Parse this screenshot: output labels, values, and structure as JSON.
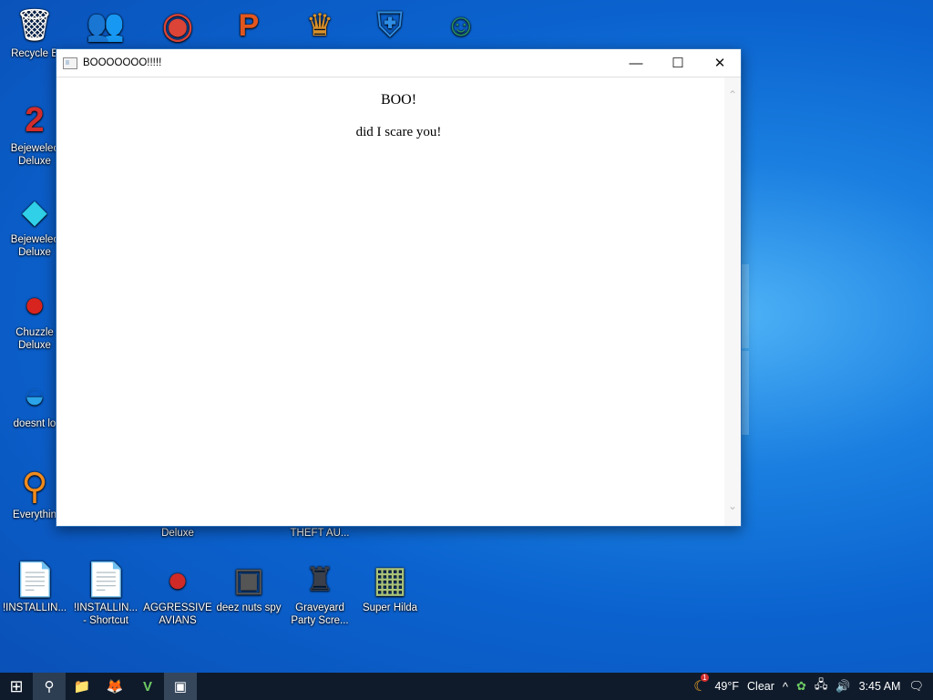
{
  "desktop": {
    "icons": [
      {
        "label": "Recycle B",
        "glyph": "🗑",
        "color": "#d8e7f5"
      },
      {
        "label": "",
        "glyph": "👥",
        "color": "#3fa34d"
      },
      {
        "label": "",
        "glyph": "◉",
        "color": "#db4437"
      },
      {
        "label": "",
        "glyph": "P",
        "color": "#e2561e"
      },
      {
        "label": "",
        "glyph": "♛",
        "color": "#d9912a"
      },
      {
        "label": "",
        "glyph": "⛨",
        "color": "#2f8de4"
      },
      {
        "label": "",
        "glyph": "☺",
        "color": "#2a8f5c"
      },
      {
        "label": "Bejewelec\nDeluxe",
        "glyph": "2",
        "color": "#d12d2d"
      },
      {
        "label": "Bejewelec\nDeluxe",
        "glyph": "◆",
        "color": "#2fd0e8"
      },
      {
        "label": "Chuzzle\nDeluxe",
        "glyph": "●",
        "color": "#d8241e"
      },
      {
        "label": "doesnt lo",
        "glyph": "◒",
        "color": "#2aa3e8"
      },
      {
        "label": "Everythin",
        "glyph": "⚲",
        "color": "#f08b1d"
      },
      {
        "label": "Deluxe",
        "glyph": "",
        "color": ""
      },
      {
        "label": "THEFT AU...",
        "glyph": "",
        "color": ""
      },
      {
        "label": "!INSTALLIN...",
        "glyph": "📄",
        "color": "#ffffff"
      },
      {
        "label": "!INSTALLIN...\n- Shortcut",
        "glyph": "📄",
        "color": "#ffffff"
      },
      {
        "label": "AGGRESSIVE\nAVIANS",
        "glyph": "●",
        "color": "#cf2a27"
      },
      {
        "label": "deez nuts spy",
        "glyph": "▣",
        "color": "#555555"
      },
      {
        "label": "Graveyard\nParty Scre...",
        "glyph": "♜",
        "color": "#3a3f4a"
      },
      {
        "label": "Super Hilda",
        "glyph": "▦",
        "color": "#a9c27a"
      }
    ]
  },
  "window": {
    "title": "BOOOOOOO!!!!!",
    "heading": "BOO!",
    "message": "did I scare you!",
    "controls": {
      "minimize": "—",
      "maximize": "☐",
      "close": "✕"
    }
  },
  "taskbar": {
    "start": "⊞",
    "search": "⚲",
    "explorer": "📁",
    "firefox": "🦊",
    "app": "V",
    "active_window": "▣",
    "weather_badge": "1",
    "temperature": "49°F",
    "condition": "Clear",
    "tray_chevron": "^",
    "time": "3:45 AM",
    "notifications": "🗨"
  }
}
